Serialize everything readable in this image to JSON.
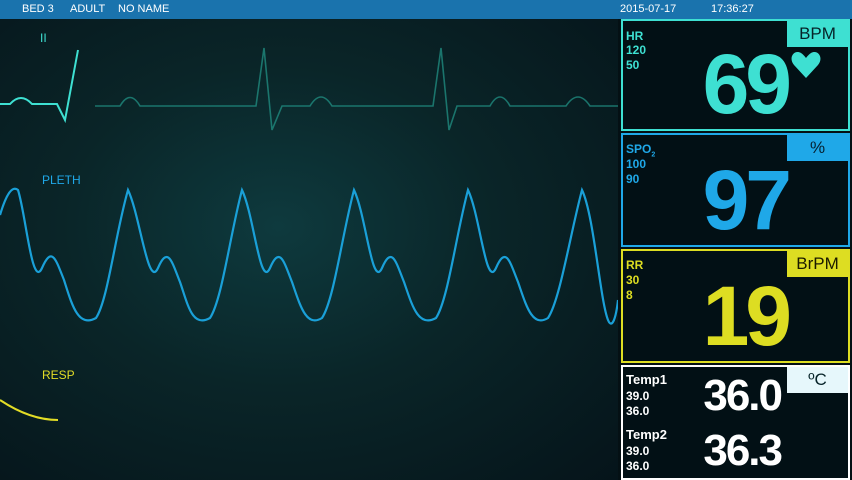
{
  "header": {
    "bed": "BED 3",
    "patient_type": "ADULT",
    "patient_name": "NO NAME",
    "date": "2015-07-17",
    "time": "17:36:27"
  },
  "waveforms": {
    "ecg_label": "II",
    "pleth_label": "PLETH",
    "resp_label": "RESP"
  },
  "hr": {
    "label": "HR",
    "high": "120",
    "low": "50",
    "value": "69",
    "unit": "BPM",
    "color": "#3ee0d2"
  },
  "spo2": {
    "label_main": "SPO",
    "label_sub": "2",
    "high": "100",
    "low": "90",
    "value": "97",
    "unit": "%",
    "color": "#1fa8e8"
  },
  "rr": {
    "label": "RR",
    "high": "30",
    "low": "8",
    "value": "19",
    "unit": "BrPM",
    "color": "#dddd22"
  },
  "temp": {
    "unit": "ºC",
    "color": "#ffffff",
    "t1": {
      "label": "Temp1",
      "high": "39.0",
      "low": "36.0",
      "value": "36.0"
    },
    "t2": {
      "label": "Temp2",
      "high": "39.0",
      "low": "36.0",
      "value": "36.3"
    }
  }
}
